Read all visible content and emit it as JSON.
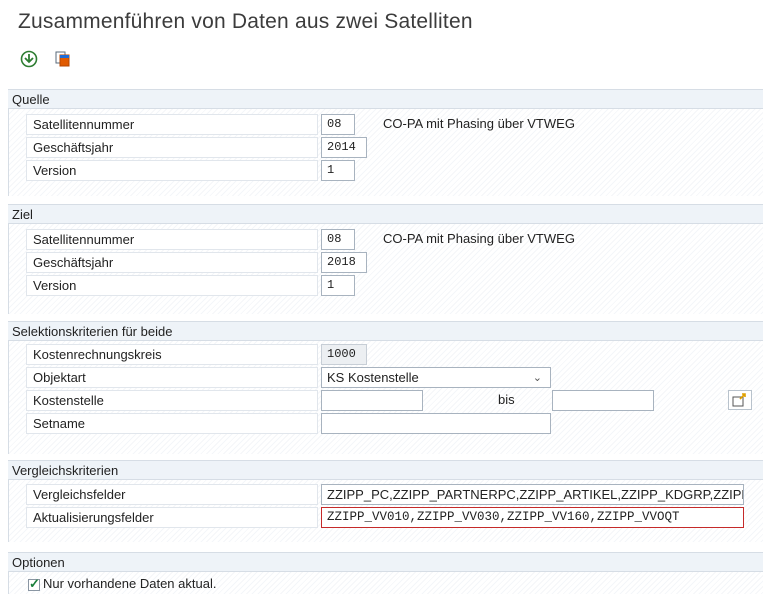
{
  "window": {
    "title": "Zusammenführen von Daten aus zwei Satelliten"
  },
  "toolbar": {
    "execute_icon": "execute-icon",
    "copy_icon": "copy-icon"
  },
  "quelle": {
    "header": "Quelle",
    "rows": [
      {
        "label": "Satellitennummer",
        "value": "08"
      },
      {
        "label": "Geschäftsjahr",
        "value": "2014"
      },
      {
        "label": "Version",
        "value": "1"
      }
    ],
    "satellite_desc": "CO-PA mit Phasing über VTWEG"
  },
  "ziel": {
    "header": "Ziel",
    "rows": [
      {
        "label": "Satellitennummer",
        "value": "08"
      },
      {
        "label": "Geschäftsjahr",
        "value": "2018"
      },
      {
        "label": "Version",
        "value": "1"
      }
    ],
    "satellite_desc": "CO-PA mit Phasing über VTWEG"
  },
  "selektion": {
    "header": "Selektionskriterien für beide",
    "kostenrechnungskreis_label": "Kostenrechnungskreis",
    "kostenrechnungskreis_value": "1000",
    "objektart_label": "Objektart",
    "objektart_value": "KS Kostenstelle",
    "kostenstelle_label": "Kostenstelle",
    "kostenstelle_from": "",
    "bis_label": "bis",
    "kostenstelle_to": "",
    "setname_label": "Setname",
    "setname_value": ""
  },
  "vergleich": {
    "header": "Vergleichskriterien",
    "vergleichsfelder_label": "Vergleichsfelder",
    "vergleichsfelder_value": "ZZIPP_PC,ZZIPP_PARTNERPC,ZZIPP_ARTIKEL,ZZIPP_KDGRP,ZZIPP...",
    "aktualisierung_label": "Aktualisierungsfelder",
    "aktualisierung_value": "ZZIPP_VV010,ZZIPP_VV030,ZZIPP_VV160,ZZIPP_VVOQT"
  },
  "optionen": {
    "header": "Optionen",
    "checkbox_label": "Nur vorhandene Daten aktual.",
    "checkbox_checked": true
  },
  "colors": {
    "header_bg": "#eef3f8",
    "focus_border": "#c52a2a",
    "check": "#1a7f3b"
  }
}
